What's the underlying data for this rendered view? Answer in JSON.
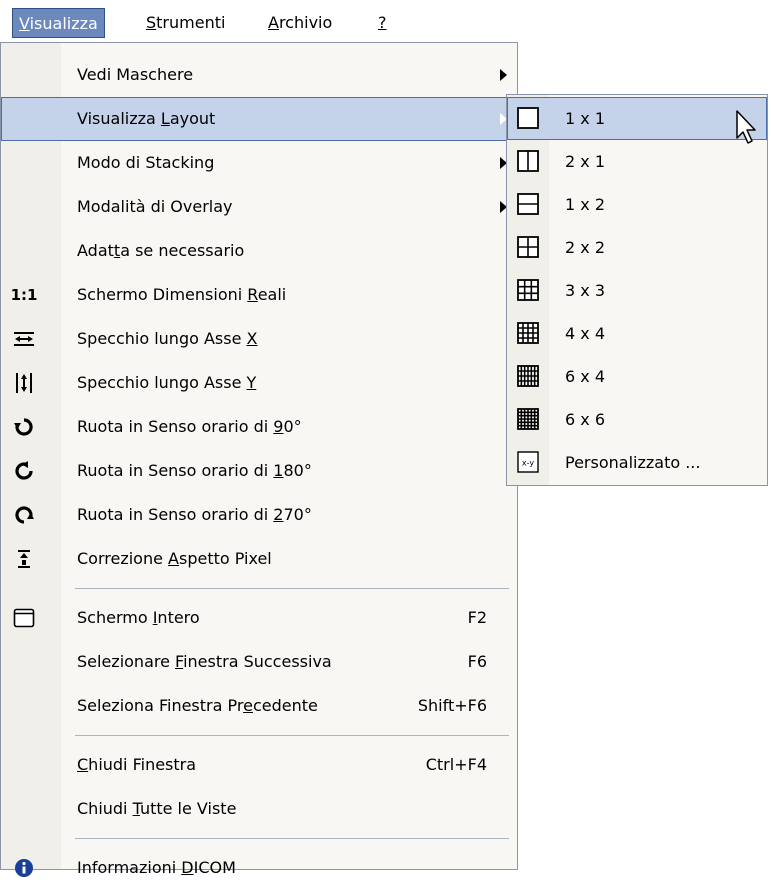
{
  "menubar": [
    {
      "pre": "",
      "u": "V",
      "post": "isualizza",
      "active": true
    },
    {
      "pre": "",
      "u": "S",
      "post": "trumenti",
      "active": false
    },
    {
      "pre": "",
      "u": "A",
      "post": "rchivio",
      "active": false
    },
    {
      "pre": "",
      "u": "?",
      "post": "",
      "active": false
    }
  ],
  "menu": [
    {
      "type": "item",
      "label": "Vedi Maschere",
      "submenu": true
    },
    {
      "type": "item",
      "label_pre": "Visualizza ",
      "u": "L",
      "label_post": "ayout",
      "submenu": true,
      "highlighted": true
    },
    {
      "type": "item",
      "label": "Modo di Stacking",
      "submenu": true
    },
    {
      "type": "item",
      "label": "Modalità di Overlay",
      "submenu": true
    },
    {
      "type": "item",
      "label_pre": "Adat",
      "u": "t",
      "label_post": "a se necessario"
    },
    {
      "type": "item",
      "icon": "actual-size-icon",
      "icon_text": "1:1",
      "label_pre": "Schermo Dimensioni ",
      "u": "R",
      "label_post": "eali"
    },
    {
      "type": "item",
      "icon": "mirror-x-icon",
      "label_pre": "Specchio lungo Asse ",
      "u": "X",
      "label_post": ""
    },
    {
      "type": "item",
      "icon": "mirror-y-icon",
      "label_pre": "Specchio lungo Asse ",
      "u": "Y",
      "label_post": ""
    },
    {
      "type": "item",
      "icon": "rotate-90-icon",
      "label_pre": "Ruota in Senso orario di ",
      "u": "9",
      "label_post": "0°"
    },
    {
      "type": "item",
      "icon": "rotate-180-icon",
      "label_pre": "Ruota in Senso orario di ",
      "u": "1",
      "label_post": "80°"
    },
    {
      "type": "item",
      "icon": "rotate-270-icon",
      "label_pre": "Ruota in Senso orario di ",
      "u": "2",
      "label_post": "70°"
    },
    {
      "type": "item",
      "icon": "pixel-aspect-icon",
      "label_pre": "Correzione ",
      "u": "A",
      "label_post": "spetto Pixel"
    },
    {
      "type": "separator"
    },
    {
      "type": "item",
      "icon": "fullscreen-icon",
      "label_pre": "Schermo ",
      "u": "I",
      "label_post": "ntero",
      "shortcut": "F2"
    },
    {
      "type": "item",
      "label_pre": "Selezionare ",
      "u": "F",
      "label_post": "inestra Successiva",
      "shortcut": "F6"
    },
    {
      "type": "item",
      "label_pre": "Seleziona Finestra Pr",
      "u": "e",
      "label_post": "cedente",
      "shortcut": "Shift+F6"
    },
    {
      "type": "separator"
    },
    {
      "type": "item",
      "label_pre": "",
      "u": "C",
      "label_post": "hiudi Finestra",
      "shortcut": "Ctrl+F4"
    },
    {
      "type": "item",
      "label_pre": "Chiudi ",
      "u": "T",
      "label_post": "utte le Viste"
    },
    {
      "type": "separator"
    },
    {
      "type": "item",
      "icon": "info-icon",
      "label_pre": "Informazioni ",
      "u": "D",
      "label_post": "ICOM"
    }
  ],
  "submenu": [
    {
      "label": "1 x 1",
      "icon": "layout-1x1-icon",
      "grid": [
        1,
        1
      ],
      "highlighted": true
    },
    {
      "label": "2 x 1",
      "icon": "layout-2x1-icon",
      "grid": [
        2,
        1
      ]
    },
    {
      "label": "1 x 2",
      "icon": "layout-1x2-icon",
      "grid": [
        1,
        2
      ]
    },
    {
      "label": "2 x 2",
      "icon": "layout-2x2-icon",
      "grid": [
        2,
        2
      ]
    },
    {
      "label": "3 x 3",
      "icon": "layout-3x3-icon",
      "grid": [
        3,
        3
      ]
    },
    {
      "label": "4 x 4",
      "icon": "layout-4x4-icon",
      "grid": [
        4,
        4
      ]
    },
    {
      "label": "6 x 4",
      "icon": "layout-6x4-icon",
      "grid": [
        6,
        4
      ]
    },
    {
      "label": "6 x 6",
      "icon": "layout-6x6-icon",
      "grid": [
        6,
        6
      ]
    },
    {
      "label": "Personalizzato ...",
      "icon": "layout-custom-icon",
      "icon_text": "x-y"
    }
  ],
  "colors": {
    "accent": "#6b89bd",
    "highlight": "#c5d3ea",
    "highlight_border": "#4c6ea6",
    "gutter": "#f0efe9",
    "menu_bg": "#f8f7f3"
  }
}
